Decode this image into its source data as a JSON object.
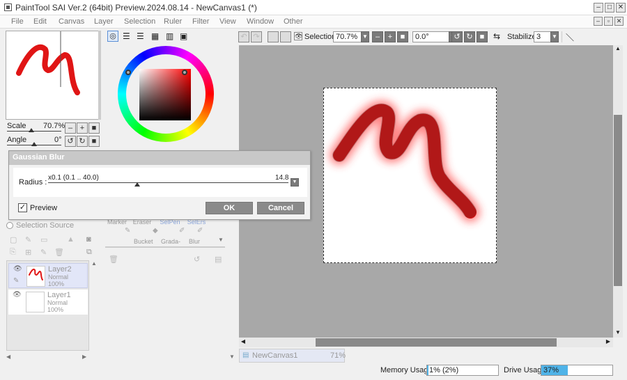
{
  "titlebar": {
    "title": "PaintTool SAI Ver.2 (64bit) Preview.2024.08.14 - NewCanvas1 (*)",
    "minimize": "–",
    "maximize": "□",
    "close": "✕"
  },
  "menu": [
    "File",
    "Edit",
    "Canvas",
    "Layer",
    "Selection",
    "Ruler",
    "Filter",
    "View",
    "Window",
    "Other"
  ],
  "navigator": {
    "scale_label": "Scale",
    "scale_value": "70.7%",
    "angle_label": "Angle",
    "angle_value": "0°"
  },
  "toolbar": {
    "selection_label": "Selection",
    "zoom_value": "70.7%",
    "angle_value": "0.0°",
    "stabilizer_label": "Stabilizer",
    "stabilizer_value": "3"
  },
  "dialog": {
    "title": "Gaussian Blur",
    "radius_label": "Radius :",
    "radius_range": "x0.1 (0.1 .. 40.0)",
    "radius_value": "14.8",
    "radius_fraction": 0.37,
    "preview_label": "Preview",
    "ok_label": "OK",
    "cancel_label": "Cancel"
  },
  "selection_source_label": "Selection Source",
  "tools": [
    {
      "label": "Marker"
    },
    {
      "label": "Eraser"
    },
    {
      "label": "SelPen"
    },
    {
      "label": "SelErs"
    },
    {
      "label": "Bucket"
    },
    {
      "label": "Grada-"
    },
    {
      "label": "Blur"
    }
  ],
  "layers": [
    {
      "name": "Layer2",
      "mode": "Normal",
      "opacity": "100%",
      "selected": true
    },
    {
      "name": "Layer1",
      "mode": "Normal",
      "opacity": "100%",
      "selected": false
    }
  ],
  "doc_tab": {
    "name": "NewCanvas1",
    "zoom": "71%"
  },
  "status": {
    "memory_label": "Memory Usage",
    "memory_value": "1% (2%)",
    "memory_fraction": 0.02,
    "drive_label": "Drive Usage",
    "drive_value": "37%",
    "drive_fraction": 0.37
  },
  "colors": {
    "stroke": "#e01515",
    "accent": "#4fb3e8"
  }
}
